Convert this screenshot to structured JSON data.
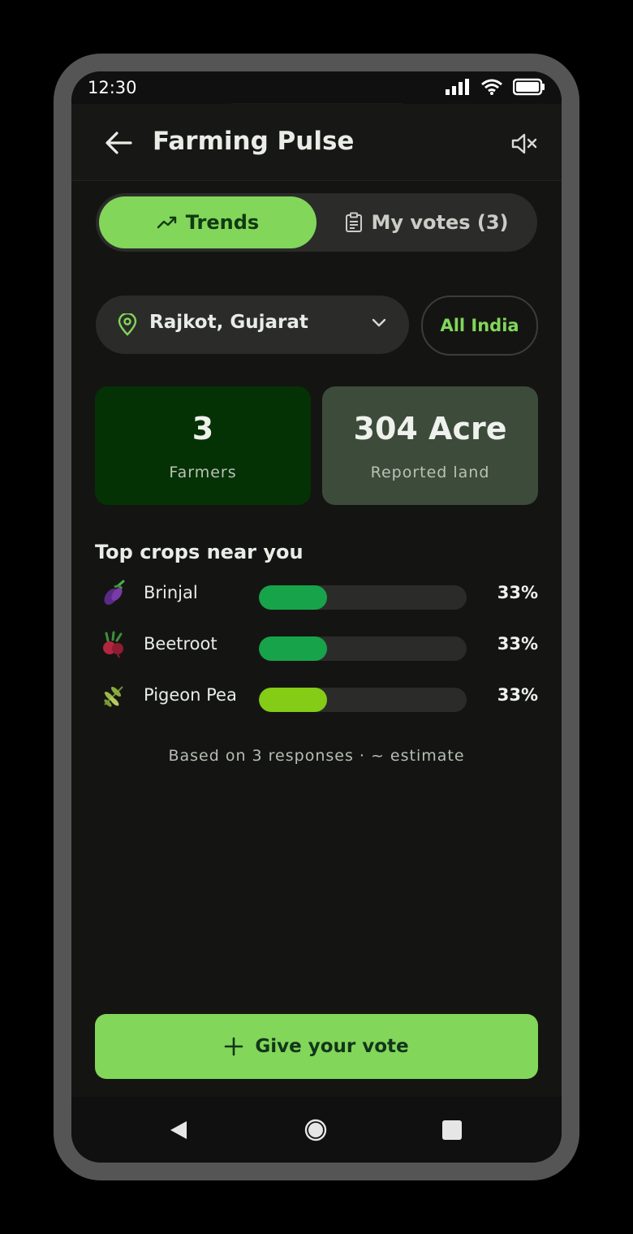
{
  "status_bar": {
    "time": "12:30"
  },
  "app_bar": {
    "title": "Farming Pulse"
  },
  "tabs": [
    {
      "label": "Trends",
      "active": true
    },
    {
      "label": "My votes (3)",
      "active": false
    }
  ],
  "location": {
    "selected": "Rajkot, Gujarat",
    "all_india_label": "All India"
  },
  "stats": [
    {
      "value": "3",
      "label": "Farmers"
    },
    {
      "value": "304 Acre",
      "label": "Reported land"
    }
  ],
  "top_crops": {
    "title": "Top crops near you",
    "items": [
      {
        "name": "Brinjal",
        "percent_label": "33%",
        "share": 0.33,
        "color": "#17a34a",
        "icon": "brinjal-icon"
      },
      {
        "name": "Beetroot",
        "percent_label": "33%",
        "share": 0.33,
        "color": "#17a34a",
        "icon": "beetroot-icon"
      },
      {
        "name": "Pigeon Pea",
        "percent_label": "33%",
        "share": 0.33,
        "color": "#84cc16",
        "icon": "pigeon-pea-icon"
      }
    ],
    "footnote": "Based on 3 responses · ~ estimate"
  },
  "actions": {
    "vote_label": "Give your vote"
  },
  "colors": {
    "accent": "#82d65a",
    "farmers_card": "#053205",
    "land_card": "#3d4b3b"
  }
}
